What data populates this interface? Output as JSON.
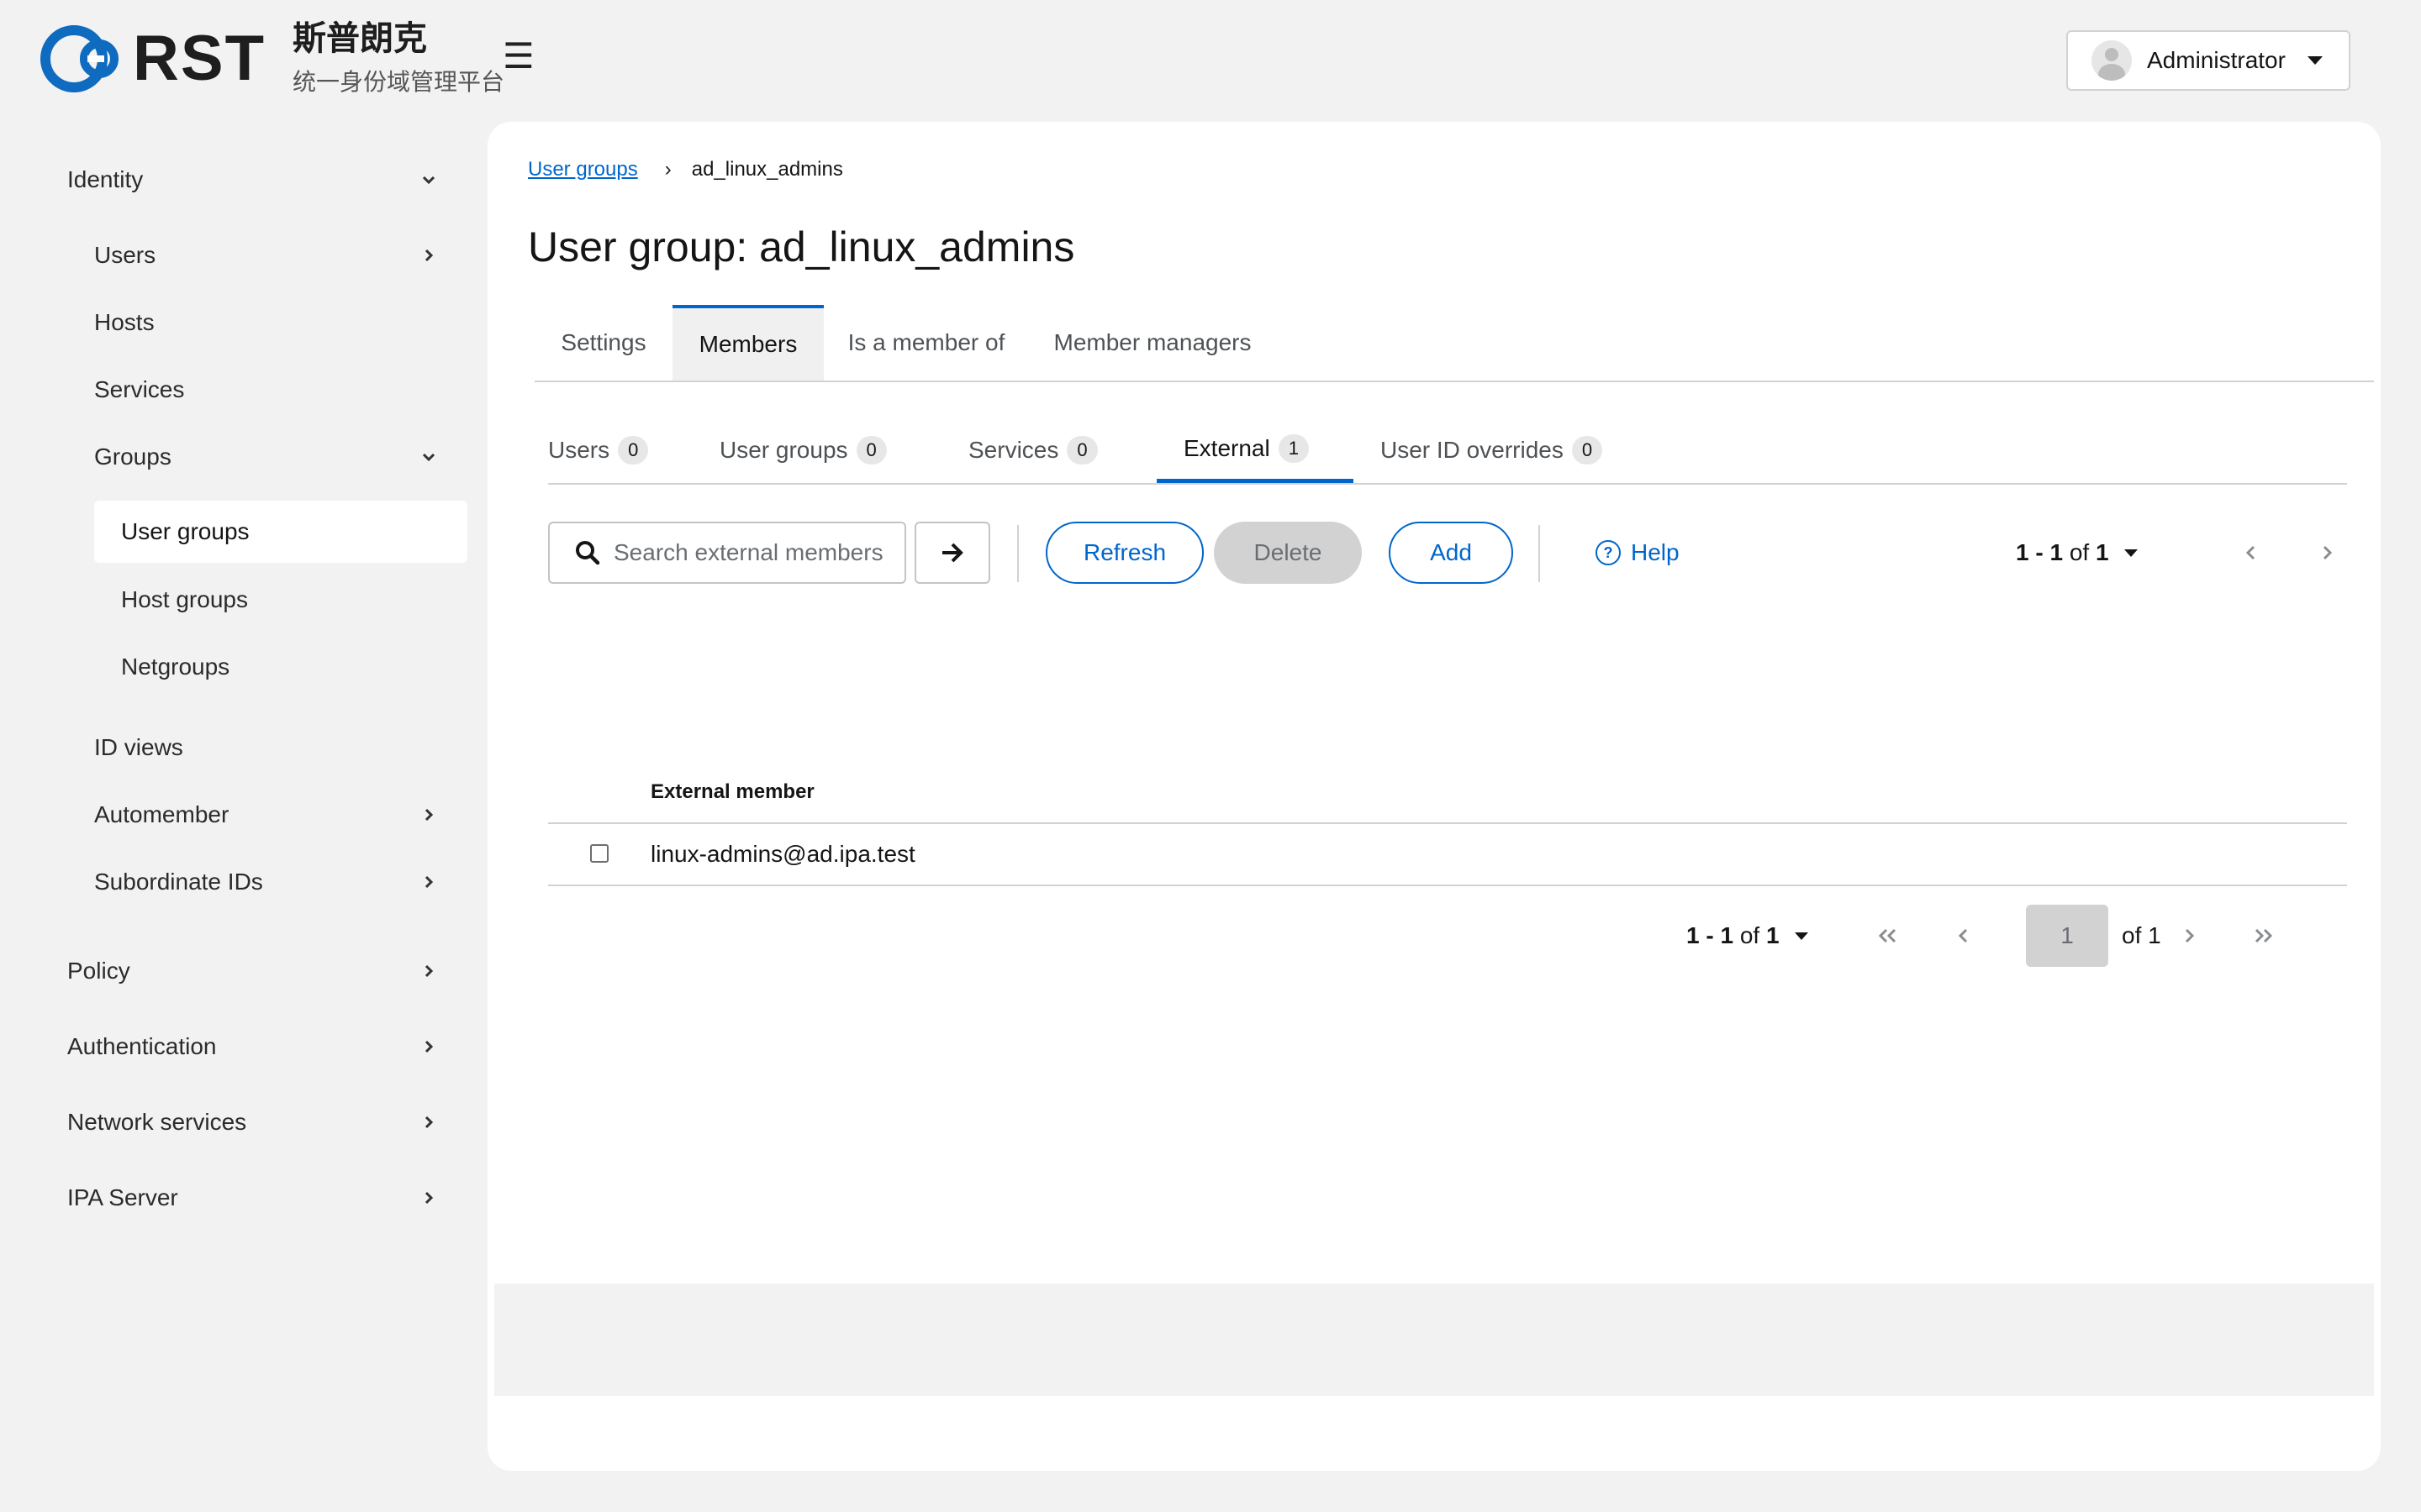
{
  "brand": {
    "logo_text": "RST",
    "name_cn": "斯普朗克",
    "subtitle_cn": "统一身份域管理平台"
  },
  "header": {
    "menu_icon": "☰",
    "user": {
      "name": "Administrator"
    }
  },
  "sidebar": {
    "items": [
      {
        "label": "Identity",
        "chevron": "down"
      },
      {
        "label": "Users",
        "chevron": "right"
      },
      {
        "label": "Hosts"
      },
      {
        "label": "Services"
      },
      {
        "label": "Groups",
        "chevron": "down"
      },
      {
        "label": "User groups",
        "active": true
      },
      {
        "label": "Host groups"
      },
      {
        "label": "Netgroups"
      },
      {
        "label": "ID views"
      },
      {
        "label": "Automember",
        "chevron": "right"
      },
      {
        "label": "Subordinate IDs",
        "chevron": "right"
      },
      {
        "label": "Policy",
        "chevron": "right"
      },
      {
        "label": "Authentication",
        "chevron": "right"
      },
      {
        "label": "Network services",
        "chevron": "right"
      },
      {
        "label": "IPA Server",
        "chevron": "right"
      }
    ]
  },
  "breadcrumb": {
    "parent": "User groups",
    "separator": "›",
    "current": "ad_linux_admins"
  },
  "page": {
    "title": "User group: ad_linux_admins"
  },
  "tabs": [
    {
      "label": "Settings"
    },
    {
      "label": "Members",
      "active": true
    },
    {
      "label": "Is a member of"
    },
    {
      "label": "Member managers"
    }
  ],
  "subtabs": [
    {
      "label": "Users",
      "count": "0"
    },
    {
      "label": "User groups",
      "count": "0"
    },
    {
      "label": "Services",
      "count": "0"
    },
    {
      "label": "External",
      "count": "1",
      "active": true
    },
    {
      "label": "User ID overrides",
      "count": "0"
    }
  ],
  "toolbar": {
    "search_placeholder": "Search external members",
    "refresh_label": "Refresh",
    "delete_label": "Delete",
    "add_label": "Add",
    "help_label": "Help"
  },
  "pagination": {
    "range_start": "1",
    "range_end": "1",
    "of_text": "of",
    "total": "1",
    "current_page": "1",
    "of_pages": "of 1"
  },
  "table": {
    "columns": [
      "External member"
    ],
    "rows": [
      {
        "external_member": "linux-admins@ad.ipa.test"
      }
    ]
  },
  "colors": {
    "accent": "#0066cc",
    "background": "#f2f2f2",
    "panel": "#ffffff"
  }
}
